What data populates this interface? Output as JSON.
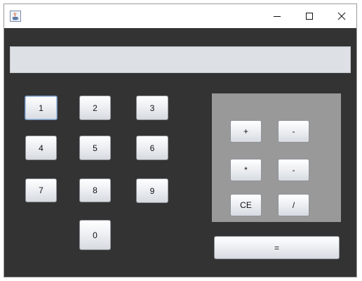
{
  "window": {
    "app_icon": "java-coffee-cup-icon",
    "controls": {
      "minimize": "minimize-icon",
      "maximize": "maximize-icon",
      "close": "close-icon"
    }
  },
  "display": {
    "value": ""
  },
  "digits": {
    "d1": "1",
    "d2": "2",
    "d3": "3",
    "d4": "4",
    "d5": "5",
    "d6": "6",
    "d7": "7",
    "d8": "8",
    "d9": "9",
    "d0": "0"
  },
  "operators": {
    "plus": "+",
    "minus_top": "-",
    "multiply": "*",
    "minus_bottom": "-",
    "clear_entry": "CE",
    "divide": "/"
  },
  "equals": "=",
  "colors": {
    "content_background": "#333333",
    "operator_panel": "#999999",
    "display_background": "#dde0e5"
  }
}
